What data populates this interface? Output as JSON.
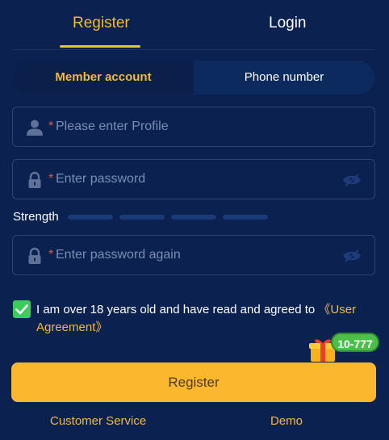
{
  "tabs": {
    "register": "Register",
    "login": "Login"
  },
  "subtabs": {
    "member": "Member account",
    "phone": "Phone number"
  },
  "fields": {
    "required_mark": "*",
    "profile_placeholder": "Please enter Profile",
    "password_placeholder": "Enter password",
    "password_again_placeholder": "Enter password again"
  },
  "strength": {
    "label": "Strength"
  },
  "agreement": {
    "checked": true,
    "text": "I am over 18 years old and have read and agreed to ",
    "link_open": "《User",
    "link_close": "Agreement》"
  },
  "promo_badge": "10-777",
  "register_button": "Register",
  "footer": {
    "customer_service": "Customer Service",
    "demo": "Demo"
  },
  "colors": {
    "accent": "#f5b938",
    "background": "#0b2150",
    "check": "#3ccc5a",
    "button": "#fbb82e"
  },
  "icons": [
    "user-icon",
    "lock-icon",
    "eye-off-icon",
    "check-icon",
    "gift-icon"
  ]
}
